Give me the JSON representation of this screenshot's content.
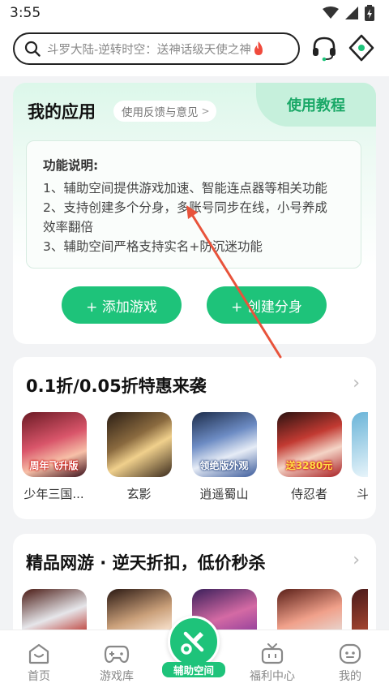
{
  "status_bar": {
    "time": "3:55"
  },
  "header": {
    "search_placeholder": "斗罗大陆-逆转时空：送神话级天使之神"
  },
  "my_apps": {
    "title": "我的应用",
    "feedback": "使用反馈与意见",
    "tutorial": "使用教程",
    "desc_title": "功能说明:",
    "desc_lines": [
      "1、辅助空间提供游戏加速、智能连点器等相关功能",
      "2、支持创建多个分身，多账号同步在线，小号养成",
      "效率翻倍",
      "3、辅助空间严格支持实名+防沉迷功能"
    ],
    "add_game": "+ 添加游戏",
    "create_clone": "+ 创建分身"
  },
  "section1": {
    "title": "0.1折/0.05折特惠来袭",
    "games": [
      {
        "name": "少年三国...",
        "badge": "周年飞升版"
      },
      {
        "name": "玄影",
        "badge": ""
      },
      {
        "name": "逍遥蜀山",
        "badge": "领绝版外观"
      },
      {
        "name": "侍忍者",
        "badge": "送3280元"
      },
      {
        "name": "斗",
        "badge": ""
      }
    ]
  },
  "section2": {
    "title": "精品网游 · 逆天折扣，低价秒杀"
  },
  "nav": {
    "home": "首页",
    "library": "游戏库",
    "assist": "辅助空间",
    "welfare": "福利中心",
    "mine": "我的"
  },
  "colors": {
    "accent": "#1ec37a",
    "annotation_arrow": "#e8533b"
  }
}
